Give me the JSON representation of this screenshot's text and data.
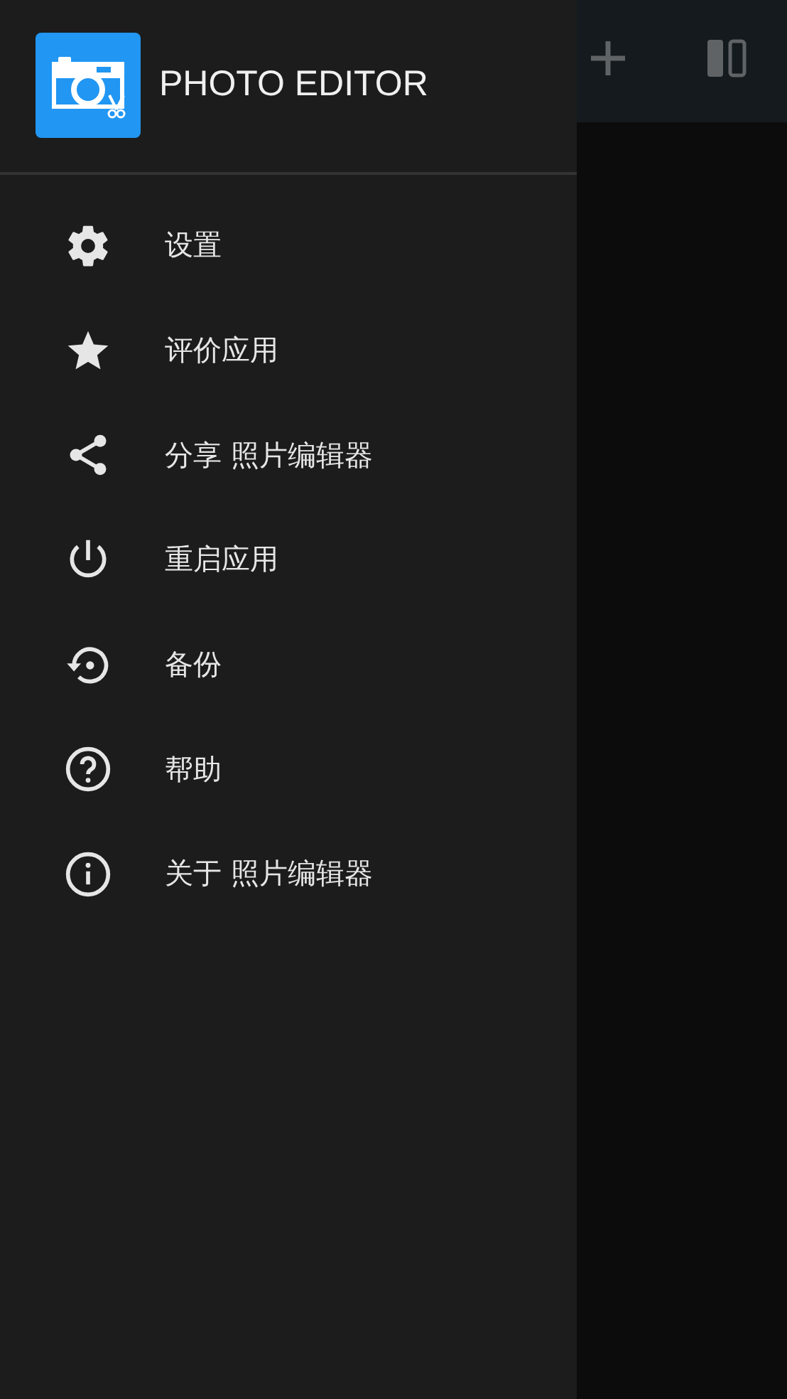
{
  "drawer": {
    "app_title": "PHOTO EDITOR",
    "items": [
      {
        "kind": "settings",
        "label": "设置"
      },
      {
        "kind": "star",
        "label": "评价应用"
      },
      {
        "kind": "share",
        "label": "分享 照片编辑器"
      },
      {
        "kind": "power",
        "label": "重启应用"
      },
      {
        "kind": "backup",
        "label": "备份"
      },
      {
        "kind": "help",
        "label": "帮助"
      },
      {
        "kind": "info",
        "label": "关于 照片编辑器"
      }
    ]
  }
}
